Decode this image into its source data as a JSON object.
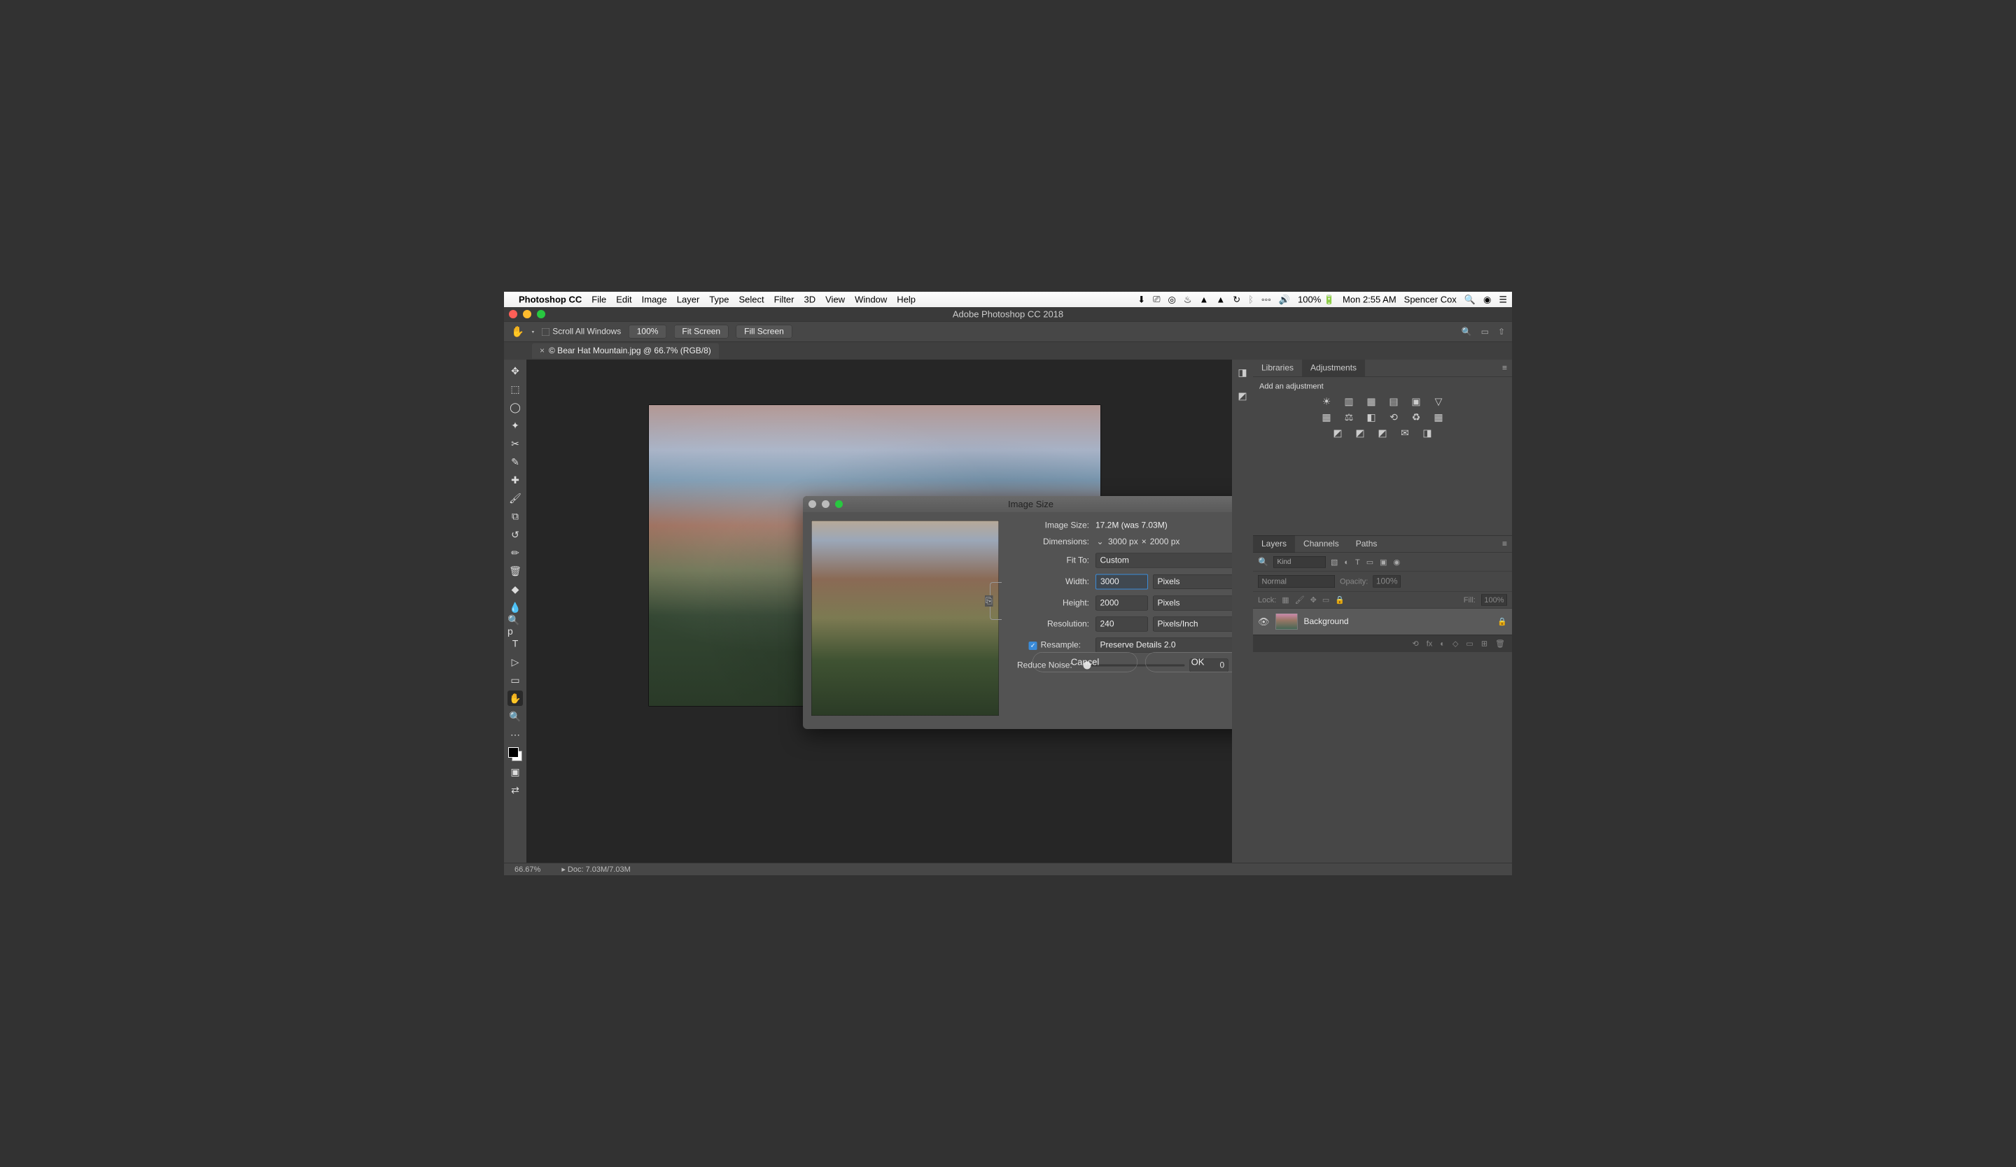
{
  "mac_menu": {
    "app": "Photoshop CC",
    "items": [
      "File",
      "Edit",
      "Image",
      "Layer",
      "Type",
      "Select",
      "Filter",
      "3D",
      "View",
      "Window",
      "Help"
    ],
    "battery": "100%",
    "clock": "Mon 2:55 AM",
    "user": "Spencer Cox"
  },
  "window": {
    "title": "Adobe Photoshop CC 2018"
  },
  "options_bar": {
    "scroll_all": "Scroll All Windows",
    "zoom": "100%",
    "fit": "Fit Screen",
    "fill": "Fill Screen"
  },
  "document_tab": {
    "close": "×",
    "label": "© Bear Hat Mountain.jpg @ 66.7% (RGB/8)"
  },
  "tools": [
    "✥",
    "⬚",
    "◯",
    "✦",
    "✂",
    "✎",
    "✚",
    "🖌",
    "⧉",
    "↺",
    "✏",
    "🗑",
    "◆",
    "💧",
    "🔍p",
    "✒",
    "T",
    "▷",
    "▭",
    "✋",
    "🔍"
  ],
  "adjustments_panel": {
    "tab_libraries": "Libraries",
    "tab_adjustments": "Adjustments",
    "title": "Add an adjustment",
    "row1": [
      "☀",
      "▥",
      "▦",
      "▤",
      "▣",
      "▽"
    ],
    "row2": [
      "▦",
      "⚖",
      "◧",
      "⟲",
      "♻",
      "▦"
    ],
    "row3": [
      "◩",
      "◩",
      "◩",
      "✉",
      "◨"
    ]
  },
  "layers_panel": {
    "tabs": {
      "layers": "Layers",
      "channels": "Channels",
      "paths": "Paths"
    },
    "kind_label": "Kind",
    "blend_mode": "Normal",
    "opacity_label": "Opacity:",
    "opacity_value": "100%",
    "lock_label": "Lock:",
    "fill_label": "Fill:",
    "fill_value": "100%",
    "layer": {
      "name": "Background"
    },
    "footer_icons": [
      "⟲",
      "fx",
      "◐",
      "◇",
      "▭",
      "⊞",
      "🗑"
    ]
  },
  "status": {
    "zoom": "66.67%",
    "doc": "Doc: 7.03M/7.03M"
  },
  "dialog": {
    "title": "Image Size",
    "image_size_label": "Image Size:",
    "image_size_value": "17.2M (was 7.03M)",
    "dimensions_label": "Dimensions:",
    "dimensions_value_w": "3000 px",
    "dimensions_times": "×",
    "dimensions_value_h": "2000 px",
    "fit_to_label": "Fit To:",
    "fit_to_value": "Custom",
    "width_label": "Width:",
    "width_value": "3000",
    "height_label": "Height:",
    "height_value": "2000",
    "unit_px": "Pixels",
    "resolution_label": "Resolution:",
    "resolution_value": "240",
    "resolution_unit": "Pixels/Inch",
    "resample_label": "Resample:",
    "resample_value": "Preserve Details 2.0",
    "noise_label": "Reduce Noise:",
    "noise_value": "0",
    "noise_pct": "%",
    "cancel": "Cancel",
    "ok": "OK"
  }
}
